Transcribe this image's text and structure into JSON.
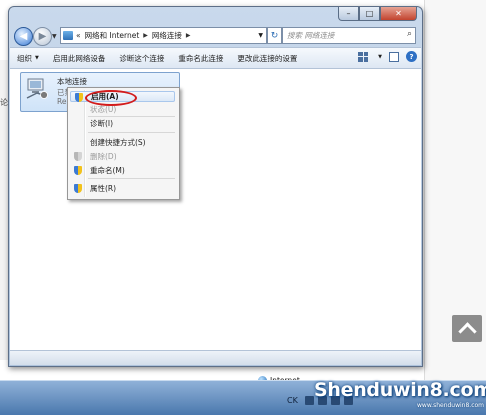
{
  "background": {
    "char": "论"
  },
  "window": {
    "caption": {
      "min": "–",
      "max": "□",
      "close": "✕"
    },
    "address_parts": [
      "网络和 Internet",
      "网络连接"
    ],
    "address_prefix": "«",
    "search_placeholder": "搜索 网络连接"
  },
  "toolbar": {
    "items": [
      {
        "label": "组织",
        "has_dropdown": true
      },
      {
        "label": "启用此网络设备"
      },
      {
        "label": "诊断这个连接"
      },
      {
        "label": "重命名此连接"
      },
      {
        "label": "更改此连接的设置"
      }
    ],
    "help": "?"
  },
  "connection": {
    "name": "本地连接",
    "status": "已禁用",
    "adapter": "Re"
  },
  "context_menu": {
    "items": [
      {
        "label": "启用(A)",
        "enabled": true,
        "shield": true,
        "highlighted": true
      },
      {
        "label": "状态(U)",
        "enabled": false,
        "shield": false
      },
      {
        "label": "诊断(I)",
        "enabled": true,
        "shield": false
      },
      {
        "label": "创建快捷方式(S)",
        "enabled": true,
        "shield": false
      },
      {
        "label": "删除(D)",
        "enabled": false,
        "shield": true
      },
      {
        "label": "重命名(M)",
        "enabled": true,
        "shield": true
      },
      {
        "label": "属性(R)",
        "enabled": true,
        "shield": true
      }
    ]
  },
  "status_zone": {
    "label": "Internet"
  },
  "taskbar": {
    "ime": "CK"
  },
  "watermark": {
    "brand": "Shenduwin8.com",
    "url": "www.shenduwin8.com"
  },
  "colors": {
    "window_frame": "#aec3dc",
    "highlight_circle": "#d21b1b",
    "taskbar": "#4a78ad"
  }
}
